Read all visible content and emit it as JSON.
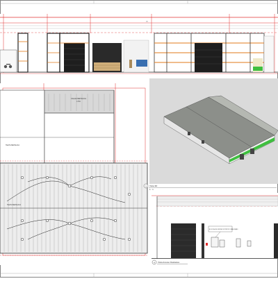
{
  "sheet": {
    "border_color": "#222222",
    "cut_color": "#e03030",
    "accent_green": "#3fbf3f",
    "accent_orange": "#e27a1a"
  },
  "views": {
    "elevation_top": {
      "label": ""
    },
    "plan": {
      "zone_top_label": "CALHA METALICA",
      "zone_top_sub": "1.5%",
      "zone_left_label": "TELHA METALICA",
      "zone_plan_label": "TELHA METALICA"
    },
    "view_3d": {
      "number": "3",
      "title": "Vista 3D",
      "scale": "1 : 1"
    },
    "access_elevation": {
      "number": "4",
      "title": "Vista Acesso Daslastes",
      "note_text": "BLOCO ALUM. MONTA C/ EXTINTOR / SINALIZAÇÃO"
    }
  }
}
